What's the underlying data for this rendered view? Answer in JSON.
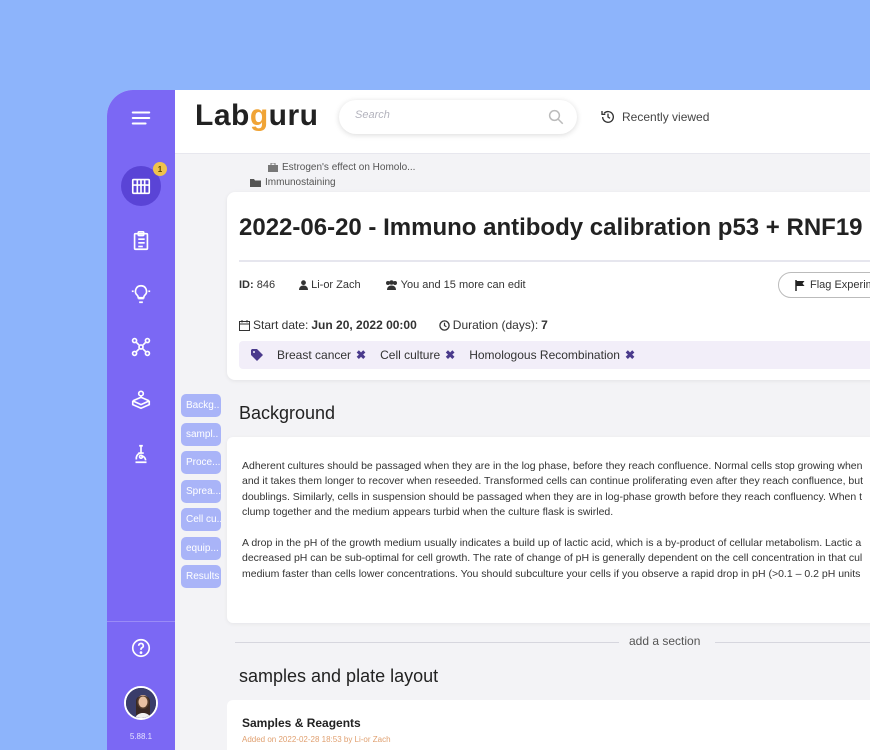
{
  "app": {
    "brand": "Labguru",
    "version": "5.88.1"
  },
  "header": {
    "search_placeholder": "Search",
    "recently_viewed": "Recently viewed"
  },
  "sidebar": {
    "items": [
      {
        "name": "experiments",
        "icon": "test-tubes-icon",
        "badge": "1",
        "active": true
      },
      {
        "name": "protocols",
        "icon": "clipboard-icon"
      },
      {
        "name": "ideas",
        "icon": "lightbulb-icon"
      },
      {
        "name": "network",
        "icon": "molecule-icon"
      },
      {
        "name": "storage",
        "icon": "box-icon"
      },
      {
        "name": "microscope",
        "icon": "microscope-icon"
      }
    ],
    "help_icon": "help-icon"
  },
  "breadcrumbs": [
    "Estrogen's effect on Homolo...",
    "Immunostaining"
  ],
  "experiment": {
    "title": "2022-06-20 - Immuno antibody calibration p53 + RNF19",
    "id_label": "ID:",
    "id_value": "846",
    "owner": "Li-or Zach",
    "editors": "You and 15 more can edit",
    "flag_button": "Flag Experim",
    "start_label": "Start date:",
    "start_value": "Jun 20, 2022 00:00",
    "duration_label": "Duration (days):",
    "duration_value": "7",
    "tags": [
      "Breast cancer",
      "Cell culture",
      "Homologous Recombination"
    ]
  },
  "section_nav": [
    "Backg..",
    "sampl..",
    "Proce...",
    "Sprea...",
    "Cell cu...",
    "equip...",
    "Results"
  ],
  "background": {
    "title": "Background",
    "paragraph1": [
      "Adherent cultures should be passaged when they are in the log phase, before they reach confluence.  Normal cells stop growing when",
      "and it takes them longer to recover when reseeded.  Transformed cells can continue proliferating even after they reach confluence, but",
      "doublings. Similarly, cells in suspension should be passaged when they are in log-phase growth before they reach confluency.  When t",
      "clump together and the medium appears turbid when the culture flask is swirled."
    ],
    "paragraph2": [
      "A drop in the pH of the growth medium usually indicates a build up of lactic acid, which is a by-product of cellular metabolism.  Lactic a",
      "decreased pH can be sub-optimal for cell growth.  The rate of change of pH is generally dependent on the cell concentration in that cul",
      "medium faster than cells lower concentrations.  You should subculture your cells if you observe a rapid drop in pH (>0.1 – 0.2 pH units"
    ]
  },
  "add_section": "add a section",
  "samples_section": {
    "title": "samples and plate layout",
    "card_title": "Samples & Reagents",
    "card_subtitle": "Added on 2022-02-28 18:53 by Li-or Zach"
  }
}
